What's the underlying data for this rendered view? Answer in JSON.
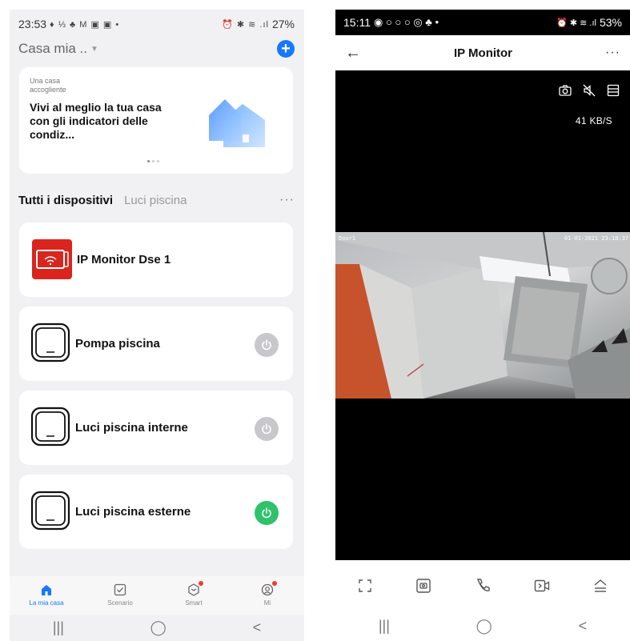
{
  "left": {
    "status": {
      "time": "23:53",
      "notif_icons": "♦ ⅓ ♣ M ▣ ▣ •",
      "right_icons": "⏰ ✱ ≋ .ıl",
      "battery": "27%"
    },
    "home": {
      "title": "Casa mia ..",
      "add_icon": "plus-circle-icon"
    },
    "banner": {
      "small_text": "Una casa accogliente",
      "headline": "Vivi al meglio la tua casa con gli indicatori delle condiz..."
    },
    "tabs": [
      "Tutti i dispositivi",
      "Luci piscina"
    ],
    "more": "···",
    "devices": [
      {
        "name": "IP Monitor Dse 1",
        "icon": "ip-monitor-icon",
        "power": null
      },
      {
        "name": "Pompa piscina",
        "icon": "switch-icon",
        "power": "off"
      },
      {
        "name": "Luci piscina interne",
        "icon": "switch-icon",
        "power": "off"
      },
      {
        "name": "Luci piscina esterne",
        "icon": "switch-icon",
        "power": "on"
      }
    ],
    "nav": [
      {
        "label": "La mia casa",
        "icon": "home-icon",
        "active": true
      },
      {
        "label": "Scenario",
        "icon": "scenario-icon",
        "active": false
      },
      {
        "label": "Smart",
        "icon": "smart-icon",
        "active": false
      },
      {
        "label": "Mi",
        "icon": "profile-icon",
        "active": false
      }
    ],
    "colors": {
      "accent": "#1677ff",
      "power_on": "#2ec26a",
      "power_off": "#c8c8cc",
      "device_red": "#d9251d"
    }
  },
  "right": {
    "status": {
      "time": "15:11",
      "notif_icons": "◉ ○ ○ ○ ◎ ♣ •",
      "right_icons": "⏰ ✱ ≋ .ıl",
      "battery": "53%"
    },
    "title": "IP Monitor",
    "back_icon": "arrow-left-icon",
    "more": "···",
    "stream_rate": "41 KB/S",
    "video": {
      "osd_left": "Door1",
      "osd_right": "01-01-2021 23:18:37"
    },
    "cam_icons": [
      "snapshot-icon",
      "mute-icon",
      "layout-icon"
    ],
    "controls": [
      "fullscreen-icon",
      "screenshot-icon",
      "phone-icon",
      "record-icon",
      "expand-up-icon"
    ]
  },
  "system_nav": {
    "recent": "|||",
    "home": "◯",
    "back": "<"
  }
}
